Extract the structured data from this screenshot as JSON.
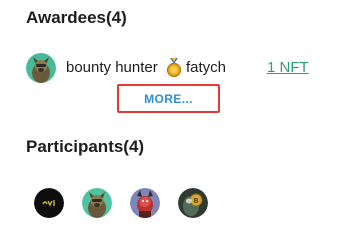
{
  "awardees": {
    "title": "Awardees(4)",
    "items": [
      {
        "avatar": "green-cartoon-dog-avatar",
        "name": "bounty hunter",
        "badge_icon": "gold-medal-icon",
        "handle": "fatych",
        "reward": "1 NFT"
      }
    ],
    "more_label": "MORE..."
  },
  "participants": {
    "title": "Participants(4)",
    "avatars": [
      "black-logo-avatar",
      "green-cartoon-dog-avatar",
      "red-character-avatar",
      "dark-coin-character-avatar"
    ]
  },
  "colors": {
    "link_green": "#2aa170",
    "more_blue": "#2c8fd6",
    "highlight_red": "#e53935",
    "text": "#1d1d1f"
  }
}
